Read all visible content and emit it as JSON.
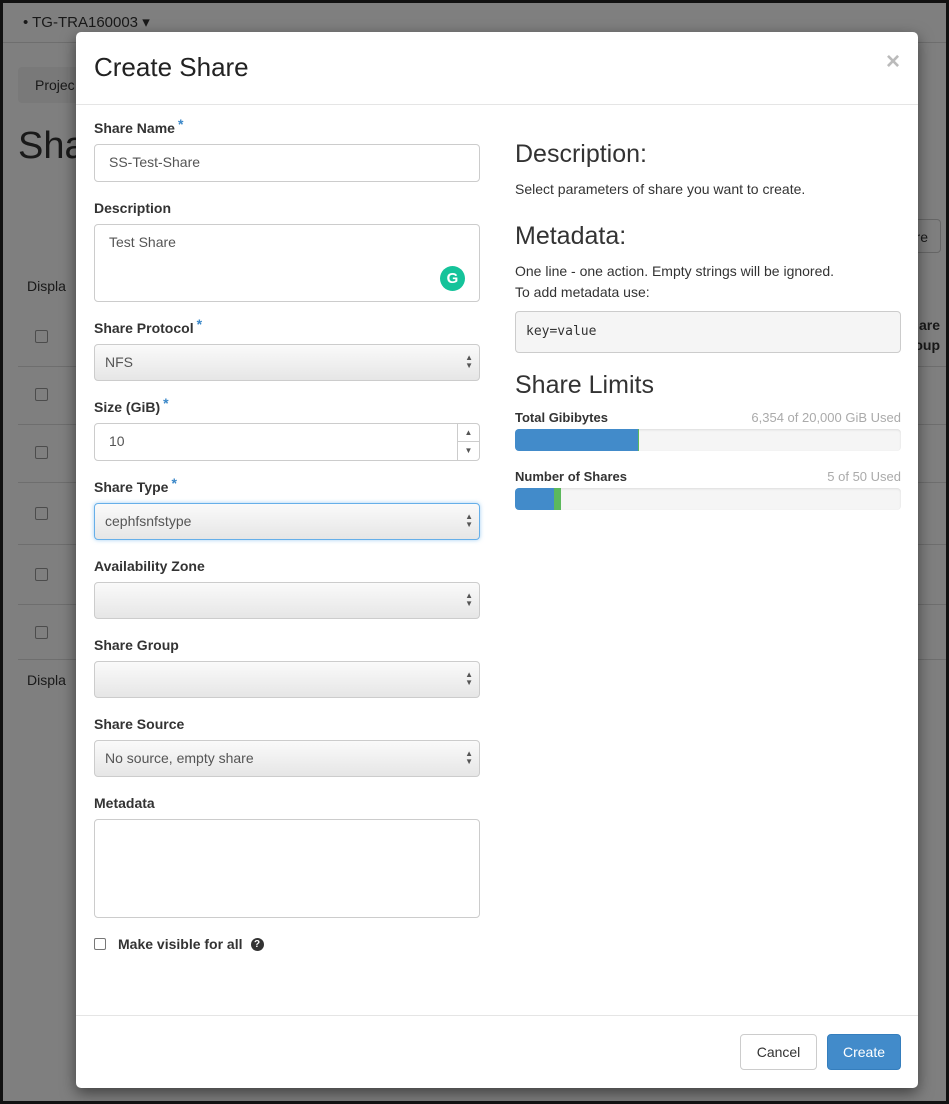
{
  "background": {
    "project": "• TG-TRA160003",
    "breadcrumb": "Projec",
    "heading": "Sha",
    "display_top": "Displa",
    "display_bottom": "Displa",
    "button_partial": "re",
    "column_partial_1": "are",
    "column_partial_2": "oup"
  },
  "modal": {
    "title": "Create Share",
    "close_icon": "×"
  },
  "form": {
    "share_name": {
      "label": "Share Name",
      "value": "SS-Test-Share"
    },
    "description": {
      "label": "Description",
      "value": "Test Share"
    },
    "share_protocol": {
      "label": "Share Protocol",
      "value": "NFS"
    },
    "size": {
      "label": "Size (GiB)",
      "value": "10"
    },
    "share_type": {
      "label": "Share Type",
      "value": "cephfsnfstype"
    },
    "availability_zone": {
      "label": "Availability Zone",
      "value": ""
    },
    "share_group": {
      "label": "Share Group",
      "value": ""
    },
    "share_source": {
      "label": "Share Source",
      "value": "No source, empty share"
    },
    "metadata": {
      "label": "Metadata",
      "value": ""
    },
    "visible_for_all": {
      "label": "Make visible for all",
      "checked": false
    },
    "required_mark": "*"
  },
  "info": {
    "description_title": "Description:",
    "description_text": "Select parameters of share you want to create.",
    "metadata_title": "Metadata:",
    "metadata_line1": "One line - one action. Empty strings will be ignored.",
    "metadata_line2": "To add metadata use:",
    "metadata_example": "key=value",
    "limits_title": "Share Limits",
    "limits": [
      {
        "label": "Total Gibibytes",
        "usage": "6,354 of 20,000 GiB Used",
        "used_percent": 31.8,
        "added_percent": 0.05
      },
      {
        "label": "Number of Shares",
        "usage": "5 of 50 Used",
        "used_percent": 10,
        "added_percent": 2
      }
    ]
  },
  "footer": {
    "cancel": "Cancel",
    "create": "Create"
  },
  "colors": {
    "primary": "#428bca",
    "success": "#5cb85c",
    "required": "#3a87c8"
  }
}
